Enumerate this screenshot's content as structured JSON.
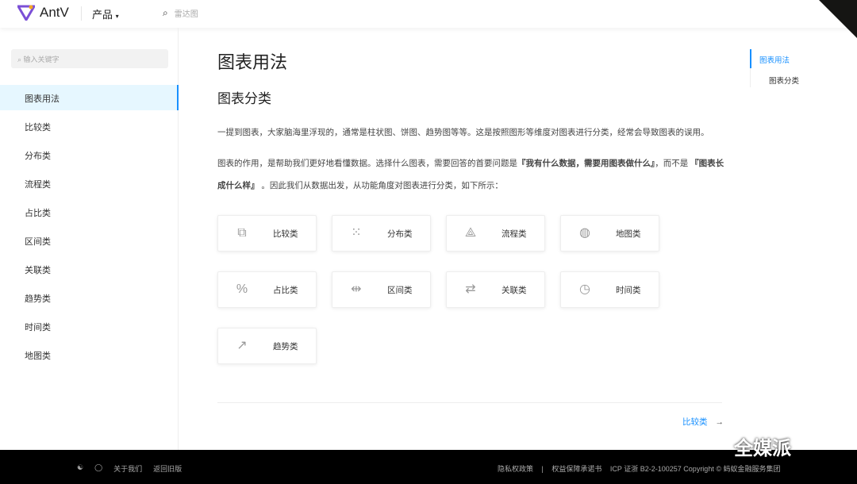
{
  "header": {
    "brand": "AntV",
    "product_menu": "产品",
    "search_placeholder": "雷达图"
  },
  "sidebar": {
    "search_placeholder": "输入关键字",
    "items": [
      {
        "label": "图表用法",
        "active": true
      },
      {
        "label": "比较类"
      },
      {
        "label": "分布类"
      },
      {
        "label": "流程类"
      },
      {
        "label": "占比类"
      },
      {
        "label": "区间类"
      },
      {
        "label": "关联类"
      },
      {
        "label": "趋势类"
      },
      {
        "label": "时间类"
      },
      {
        "label": "地图类"
      }
    ]
  },
  "main": {
    "title": "图表用法",
    "subtitle": "图表分类",
    "para1": "一提到图表，大家脑海里浮现的，通常是柱状图、饼图、趋势图等等。这是按照图形等维度对图表进行分类，经常会导致图表的误用。",
    "para2a": "图表的作用，是帮助我们更好地看懂数据。选择什么图表，需要回答的首要问题是",
    "para2b": "『我有什么数据，需要用图表做什么』",
    "para2c": "，而不是 ",
    "para2d": "『图表长成什么样』",
    "para2e": " 。因此我们从数据出发，从功能角度对图表进行分类，如下所示：",
    "cards": [
      {
        "label": "比较类",
        "icon": "compare-icon"
      },
      {
        "label": "分布类",
        "icon": "distribution-icon"
      },
      {
        "label": "流程类",
        "icon": "flow-icon"
      },
      {
        "label": "地图类",
        "icon": "globe-icon"
      },
      {
        "label": "占比类",
        "icon": "percent-icon"
      },
      {
        "label": "区间类",
        "icon": "interval-icon"
      },
      {
        "label": "关联类",
        "icon": "relation-icon"
      },
      {
        "label": "时间类",
        "icon": "clock-icon"
      },
      {
        "label": "趋势类",
        "icon": "trend-icon"
      }
    ],
    "next_label": "比较类"
  },
  "toc": {
    "items": [
      "图表用法",
      "图表分类"
    ]
  },
  "footer": {
    "about": "关于我们",
    "old_version": "返回旧版",
    "privacy": "隐私权政策",
    "rights": "权益保障承诺书",
    "icp": "ICP 证浙 B2-2-100257 Copyright © 蚂蚁金融服务集团"
  },
  "watermark": "全媒派"
}
